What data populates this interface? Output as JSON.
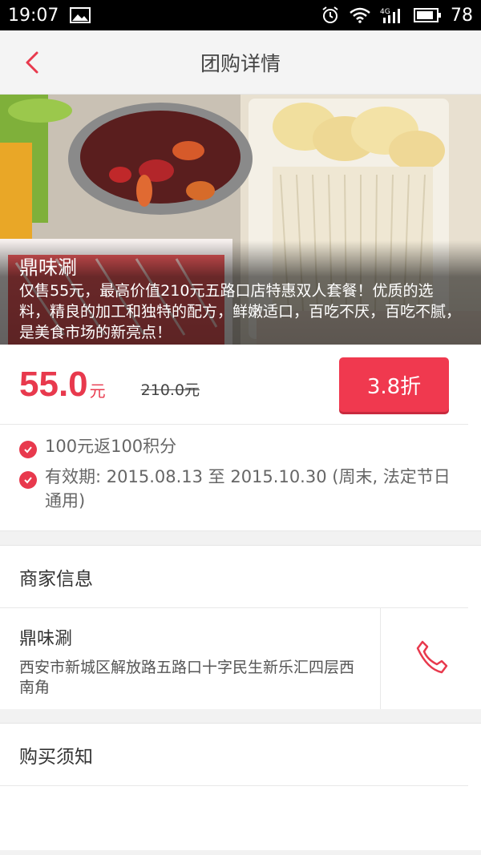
{
  "statusbar": {
    "time": "19:07",
    "battery": "78",
    "icons": [
      "image-icon",
      "alarm-icon",
      "wifi-icon",
      "signal-4g-icon",
      "battery-icon"
    ]
  },
  "navbar": {
    "title": "团购详情",
    "back_icon": "chevron-left-icon"
  },
  "hero": {
    "shop_name": "鼎味涮",
    "description": "仅售55元，最高价值210元五路口店特惠双人套餐！优质的选料，精良的加工和独特的配方，鲜嫩适口，百吃不厌，百吃不腻，是美食市场的新亮点！"
  },
  "price": {
    "current": "55.0",
    "unit": "元",
    "original": "210.0元",
    "discount_label": "3.8折"
  },
  "perks": [
    {
      "text": "100元返100积分"
    },
    {
      "text": "有效期: 2015.08.13 至 2015.10.30 (周末, 法定节日通用)"
    }
  ],
  "merchant": {
    "section_title": "商家信息",
    "name": "鼎味涮",
    "address": "西安市新城区解放路五路口十字民生新乐汇四层西南角",
    "call_icon": "phone-icon"
  },
  "notice": {
    "section_title": "购买须知"
  },
  "colors": {
    "accent": "#e8394d",
    "button": "#f0394f"
  }
}
